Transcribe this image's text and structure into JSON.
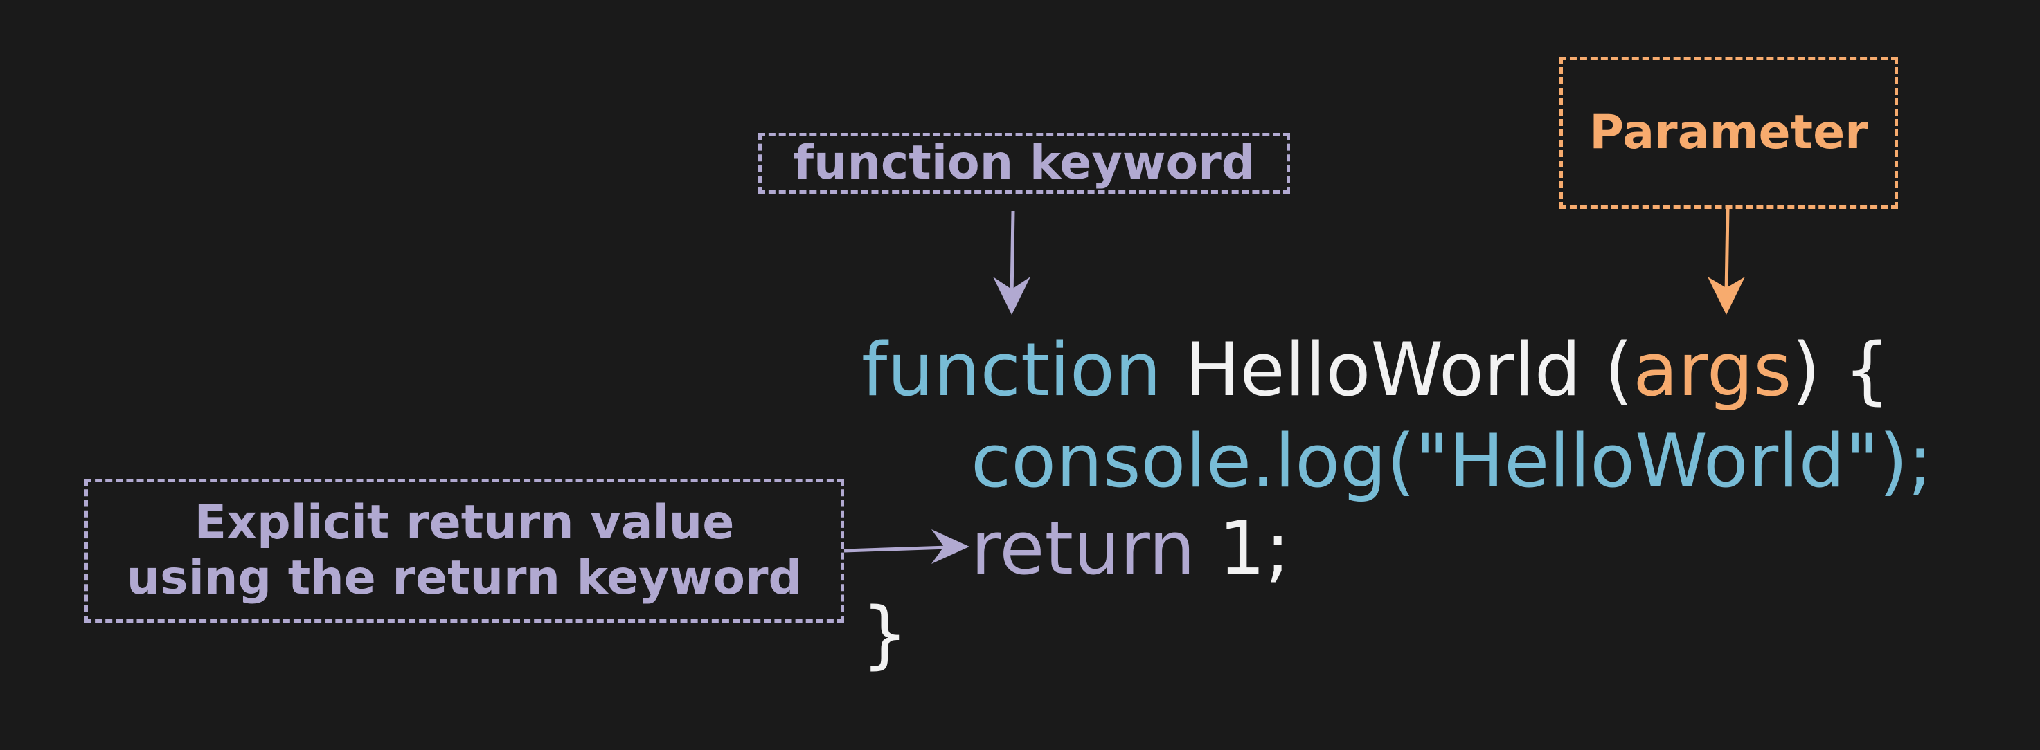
{
  "labels": {
    "function_keyword": "function keyword",
    "parameter": "Parameter",
    "return_line1": "Explicit return value",
    "return_line2": "using the return keyword"
  },
  "code": {
    "line1": {
      "keyword": "function",
      "name": " HelloWorld ",
      "open_paren": "(",
      "param": "args",
      "close": ") {"
    },
    "line2": "console.log(\"HelloWorld\");",
    "line3": {
      "keyword": "return",
      "value": " 1;"
    },
    "line4": "}"
  },
  "colors": {
    "background": "#1a1a1a",
    "purple": "#b1a9d1",
    "orange": "#f7ab6e",
    "blue": "#78bcd6",
    "white": "#f2f2f2"
  }
}
